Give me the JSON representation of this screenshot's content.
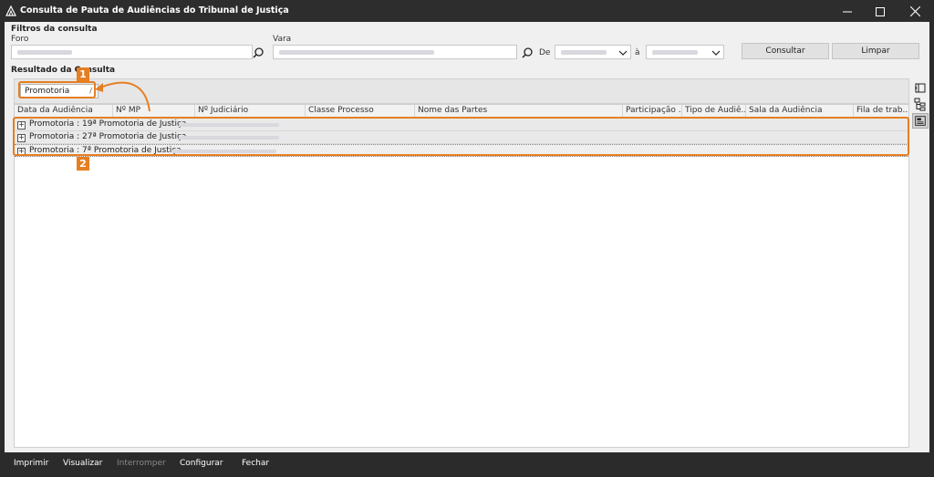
{
  "window": {
    "title": "Consulta de Pauta de Audiências do Tribunal de Justiça",
    "minimize_icon": "minimize-icon",
    "maximize_icon": "maximize-icon",
    "close_icon": "close-icon"
  },
  "filters": {
    "section_label": "Filtros da consulta",
    "foro_label": "Foro",
    "vara_label": "Vara",
    "de_label": "De",
    "a_label": "à",
    "consultar_label": "Consultar",
    "limpar_label": "Limpar"
  },
  "result": {
    "section_label": "Resultado da Consulta",
    "group_chip_label": "Promotoria",
    "group_chip_sort": "/",
    "columns": [
      "Data da Audiência",
      "Nº MP",
      "Nº Judiciário",
      "Classe Processo",
      "Nome das Partes",
      "Participação ...",
      "Tipo de Audiê...",
      "Sala da Audiência",
      "Fila de trab..."
    ],
    "groups": [
      "Promotoria : 19ª Promotoria de Justiça",
      "Promotoria : 27ª Promotoria de Justiça",
      "Promotoria : 7ª Promotoria de Justiça"
    ]
  },
  "annotations": {
    "badge1": "1",
    "badge2": "2",
    "accent_color": "#e67e22"
  },
  "bottom": {
    "imprimir": "Imprimir",
    "visualizar": "Visualizar",
    "interromper": "Interromper",
    "configurar": "Configurar",
    "fechar": "Fechar"
  }
}
